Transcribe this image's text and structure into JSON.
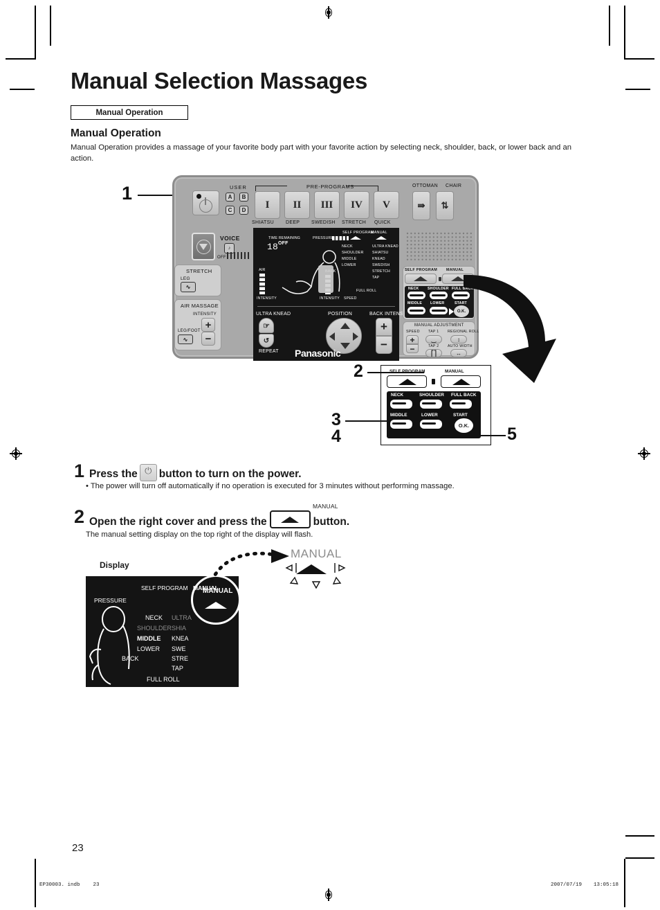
{
  "page": {
    "title": "Manual Selection Massages",
    "tag": "Manual Operation",
    "section_heading": "Manual Operation",
    "intro": "Manual Operation provides a massage of your favorite body part with your favorite action by selecting neck, shoulder, back, or lower back and an action.",
    "page_number": "23"
  },
  "footer": {
    "file": "EP30003. indb",
    "folio": "23",
    "date": "2007/07/19",
    "time": "13:05:18"
  },
  "steps": [
    {
      "number": "1",
      "text_before": "Press the",
      "icon": "power-icon",
      "text_after": "button to turn on the power.",
      "note": "• The power will turn off automatically if no operation is executed for 3 minutes without performing massage."
    },
    {
      "number": "2",
      "text_before": "Open the right cover and press the",
      "icon_caption": "MANUAL",
      "text_after": "button.",
      "note": "The manual setting display on the top right of the display will flash."
    }
  ],
  "panel": {
    "brand": "Panasonic",
    "callout_1": "1",
    "user_label": "USER",
    "user_keys": [
      "A",
      "B",
      "C",
      "D"
    ],
    "preprograms_label": "PRE-PROGRAMS",
    "programs": [
      {
        "numeral": "I",
        "name": "SHIATSU"
      },
      {
        "numeral": "II",
        "name": "DEEP"
      },
      {
        "numeral": "III",
        "name": "SWEDISH"
      },
      {
        "numeral": "IV",
        "name": "STRETCH"
      },
      {
        "numeral": "V",
        "name": "QUICK"
      }
    ],
    "ottoman_label": "OTTOMAN",
    "chair_label": "CHAIR",
    "voice_label": "VOICE",
    "voice_off": "OFF",
    "stretch_label": "STRETCH",
    "stretch_leg": "LEG",
    "air_massage_label": "AIR MASSAGE",
    "air_intensity": "INTENSITY",
    "air_legfoot": "LEG/FOOT",
    "ultra_knead_label": "ULTRA KNEAD",
    "repeat_label": "REPEAT",
    "position_label": "POSITION",
    "back_intensity_label": "BACK INTENSITY",
    "plus": "+",
    "minus": "−",
    "lcd": {
      "time_remaining": "TIME REMAINING",
      "time_value": "18",
      "off": "OFF",
      "pressure": "PRESSURE",
      "self_program": "SELF PROGRAM",
      "manual": "MANUAL",
      "parts": [
        "NECK",
        "SHOULDER",
        "MIDDLE",
        "LOWER"
      ],
      "actions": [
        "ULTRA KNEAD",
        "SHIATSU",
        "KNEAD",
        "SWEDISH",
        "STRETCH",
        "TAP"
      ],
      "air": "AIR",
      "air_intensity": "INTENSITY",
      "back": "BACK",
      "back_intensity": "INTENSITY",
      "speed": "SPEED",
      "full_roll": "FULL ROLL"
    },
    "right_cover": {
      "self_program": "SELF PROGRAM",
      "manual": "MANUAL",
      "parts": [
        "NECK",
        "SHOULDER",
        "FULL BACK",
        "MIDDLE",
        "LOWER"
      ],
      "start": "START",
      "ok": "O.K.",
      "manual_adjustment": "MANUAL ADJUSTMENT",
      "speed": "SPEED",
      "tap1": "TAP 1",
      "tap2": "TAP 2",
      "regional_roll": "REGIONAL ROLL",
      "auto_width": "AUTO WIDTH"
    }
  },
  "callout": {
    "self_program": "SELF PROGRAM",
    "manual": "MANUAL",
    "parts": [
      "NECK",
      "SHOULDER",
      "FULL BACK",
      "MIDDLE",
      "LOWER"
    ],
    "start": "START",
    "ok": "O.K.",
    "numbers": [
      "2",
      "3",
      "4",
      "5"
    ]
  },
  "display_figure": {
    "caption": "Display",
    "pressure": "PRESSURE",
    "self_program": "SELF PROGRAM",
    "manual": "MANUAL",
    "parts": [
      "NECK",
      "SHOULDER",
      "MIDDLE",
      "LOWER"
    ],
    "back": "BACK",
    "actions": [
      "ULTRA",
      "SHIA",
      "KNEA",
      "SWE",
      "STRE",
      "TAP"
    ],
    "full_roll": "FULL ROLL",
    "highlight_label": "MANUAL"
  },
  "colors": {
    "panel_body": "#a9a9a9",
    "panel_key": "#cfcfcf",
    "lcd_bg": "#151515",
    "ink": "#1a1a1a"
  }
}
